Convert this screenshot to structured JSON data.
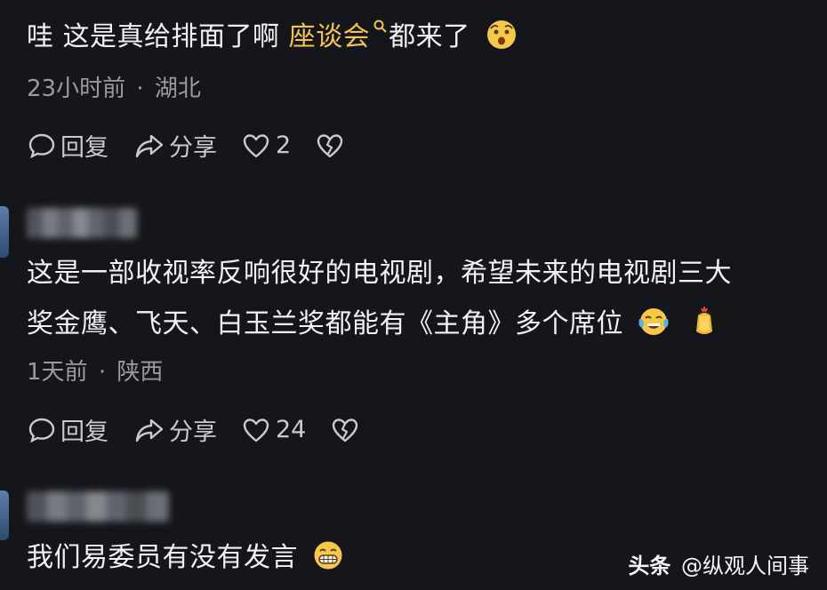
{
  "comments": [
    {
      "text_part1": "哇  这是真给排面了啊  ",
      "topic_link": "座谈会",
      "text_part2": "都来了",
      "emoji_icon": "astonished-face-emoji",
      "time": "23小时前",
      "separator": "·",
      "location": "湖北",
      "reply_label": "回复",
      "share_label": "分享",
      "like_count": "2"
    },
    {
      "line1": "这是一部收视率反响很好的电视剧，希望未来的电视剧三大",
      "line2": "奖金鹰、飞天、白玉兰奖都能有《主角》多个席位",
      "emoji_icons": [
        "laughing-crying-face-emoji",
        "clapping-hands-emoji"
      ],
      "time": "1天前",
      "separator": "·",
      "location": "陕西",
      "reply_label": "回复",
      "share_label": "分享",
      "like_count": "24"
    },
    {
      "text": "我们易委员有没有发言",
      "emoji_icon": "grinning-face-emoji"
    }
  ],
  "watermark": {
    "brand": "头条",
    "author": "@纵观人间事"
  },
  "colors": {
    "background": "#15161c",
    "topic": "#f2c44d",
    "meta": "#9a9ba1"
  }
}
